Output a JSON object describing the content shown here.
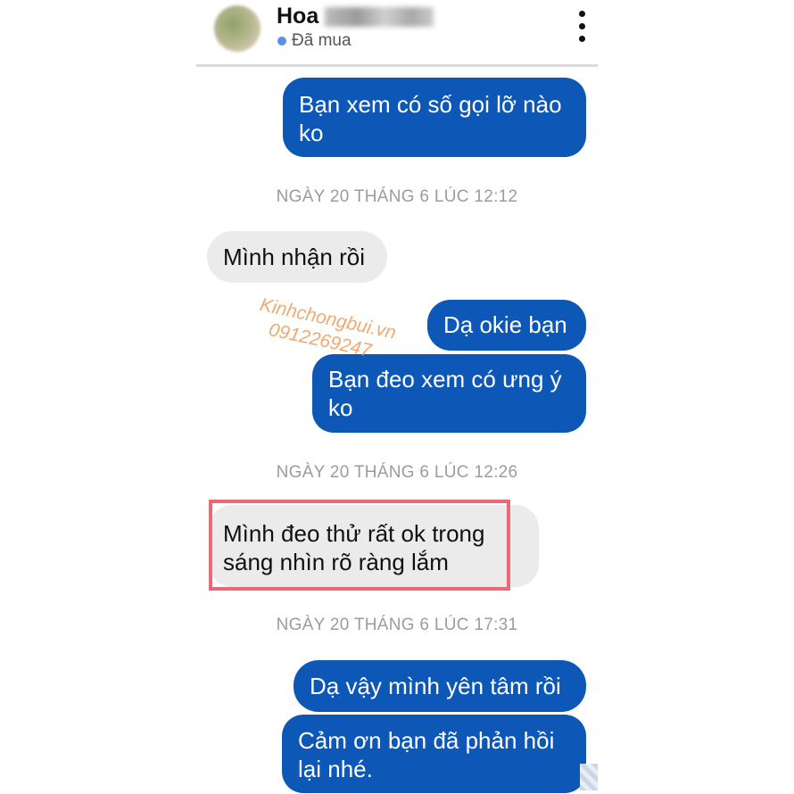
{
  "header": {
    "contact_name": "Hoa",
    "status": "Đã mua",
    "more_icon": "more-vertical-icon"
  },
  "messages": [
    {
      "type": "outgoing",
      "text": "Bạn xem có số gọi lỡ nào\nko"
    },
    {
      "type": "timestamp",
      "text": "NGÀY 20 THÁNG 6 LÚC 12:12"
    },
    {
      "type": "incoming",
      "text": "Mình nhận rồi"
    },
    {
      "type": "outgoing",
      "text": "Dạ okie bạn"
    },
    {
      "type": "outgoing",
      "text": "Bạn đeo xem có ưng ý\nko"
    },
    {
      "type": "timestamp",
      "text": "NGÀY 20 THÁNG 6 LÚC 12:26"
    },
    {
      "type": "incoming",
      "text": "Mình đeo thử rất ok trong\nsáng nhìn rõ ràng lắm",
      "highlighted": true
    },
    {
      "type": "timestamp",
      "text": "NGÀY 20 THÁNG 6 LÚC 17:31"
    },
    {
      "type": "outgoing",
      "text": "Dạ vậy mình yên tâm rồi"
    },
    {
      "type": "outgoing",
      "text": "Cảm ơn bạn đã phản hồi\nlại nhé."
    }
  ],
  "watermark": {
    "site": "Kinhchongbui.vn",
    "phone": "0912269247"
  },
  "colors": {
    "outgoing_bubble": "#0d57b7",
    "incoming_bubble": "#ebebeb",
    "highlight_border": "#e86a78",
    "watermark": "#f0a060",
    "status_dot": "#5b8def"
  }
}
